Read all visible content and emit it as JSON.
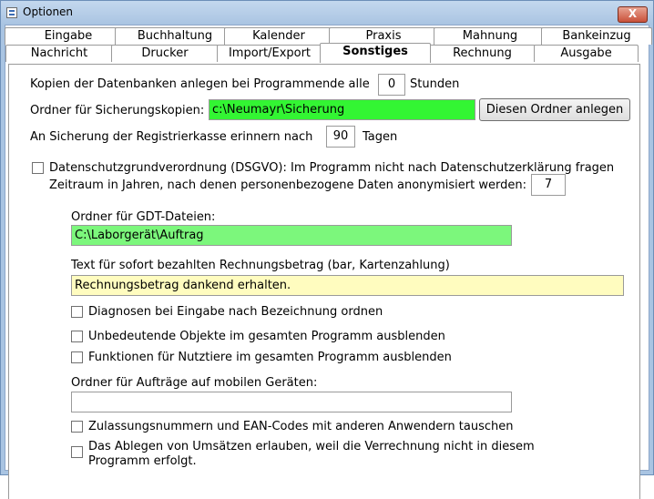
{
  "window": {
    "title": "Optionen",
    "close_symbol": "X",
    "app_icon": "options-window-icon"
  },
  "tabs": {
    "row_back": [
      "Eingabe",
      "Buchhaltung",
      "Kalender",
      "Praxis",
      "Mahnung",
      "Bankeinzug"
    ],
    "row_front": [
      "Nachricht",
      "Drucker",
      "Import/Export",
      "Sonstiges",
      "Rechnung",
      "Ausgabe"
    ],
    "active": "Sonstiges"
  },
  "settings": {
    "copies_label": "Kopien der Datenbanken anlegen bei Programmende alle",
    "copies_value": "0",
    "copies_unit": "Stunden",
    "backup_folder_label": "Ordner für Sicherungskopien:",
    "backup_folder_value": "c:\\Neumayr\\Sicherung",
    "create_folder_button": "Diesen Ordner anlegen",
    "register_backup_label": "An Sicherung der Registrierkasse erinnern nach",
    "register_backup_value": "90",
    "register_backup_unit": "Tagen",
    "dsgvo_label": "Datenschutzgrundverordnung (DSGVO): Im Programm nicht nach Datenschutzerklärung fragen",
    "dsgvo_checked": false,
    "anonymize_label": "Zeitraum in Jahren, nach denen personenbezogene Daten anonymisiert werden:",
    "anonymize_value": "7",
    "gdt_folder_label": "Ordner für GDT-Dateien:",
    "gdt_folder_value": "C:\\Laborgerät\\Auftrag",
    "paid_text_label": "Text für sofort bezahlten Rechnungsbetrag (bar, Kartenzahlung)",
    "paid_text_value": "Rechnungsbetrag dankend erhalten.",
    "diagnosen_label": "Diagnosen bei Eingabe nach Bezeichnung ordnen",
    "objekte_label": "Unbedeutende Objekte im gesamten Programm ausblenden",
    "nutztiere_label": "Funktionen für Nutztiere im gesamten Programm ausblenden",
    "mobile_folder_label": "Ordner für Aufträge auf mobilen Geräten:",
    "mobile_folder_value": "",
    "zulassung_label": "Zulassungsnummern und EAN-Codes mit anderen Anwendern tauschen",
    "umsaetze_label_line1": "Das Ablegen von Umsätzen erlauben, weil die Verrechnung nicht in diesem",
    "umsaetze_label_line2": "Programm erfolgt."
  },
  "colors": {
    "green_field": "#33f533",
    "light_green_field": "#7cf77c",
    "yellow_field": "#fffcbf",
    "close_button": "#c9513a"
  }
}
